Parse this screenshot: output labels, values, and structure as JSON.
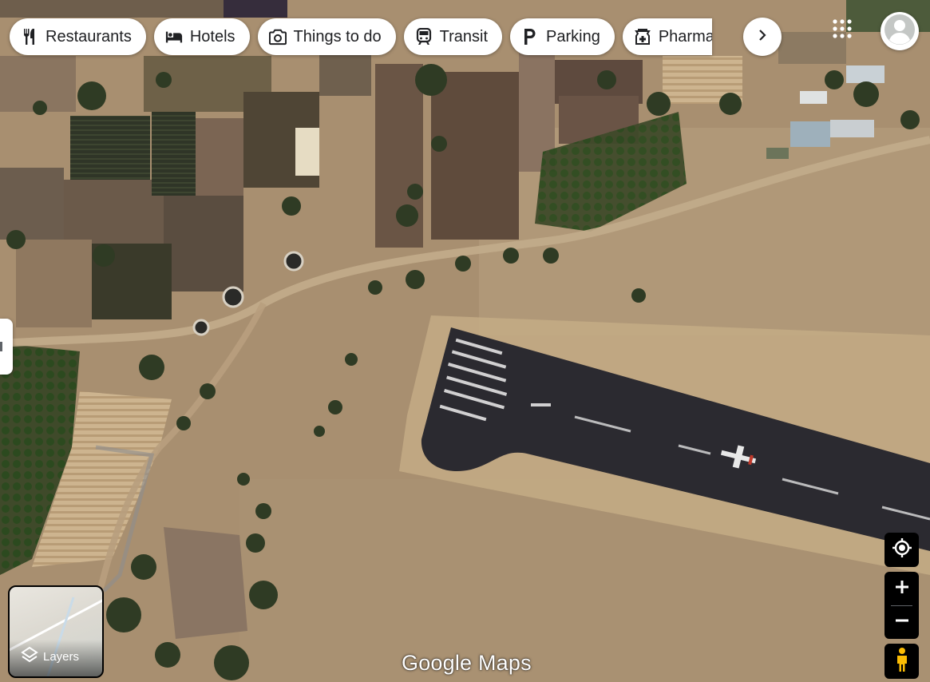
{
  "categories": [
    {
      "label": "Restaurants",
      "icon": "fork-knife-icon"
    },
    {
      "label": "Hotels",
      "icon": "bed-icon"
    },
    {
      "label": "Things to do",
      "icon": "camera-icon"
    },
    {
      "label": "Transit",
      "icon": "train-icon"
    },
    {
      "label": "Parking",
      "icon": "parking-icon"
    },
    {
      "label": "Pharmacies",
      "icon": "pharmacy-icon"
    }
  ],
  "layers": {
    "label": "Layers"
  },
  "branding": {
    "text": "Google Maps"
  },
  "colors": {
    "chip_bg": "#ffffff",
    "control_bg": "#000000",
    "pegman": "#fbbc04",
    "runway": "#2b2a30",
    "terrain": "#a38f72"
  }
}
